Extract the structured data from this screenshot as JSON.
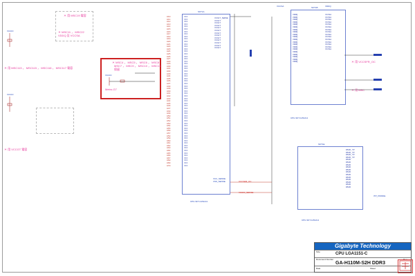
{
  "title_block": {
    "company": "Gigabyte Technology",
    "sheet_title": "CPU LGA1151-C",
    "board": "GA-H110M-S2H DDR3",
    "size_label": "Size",
    "size_value": "Custom",
    "doc_label": "Document Number",
    "rev_label": "Rev",
    "date_label": "Date",
    "sheet_label": "Sheet"
  },
  "notes": {
    "top_note_1": "＊ 用 MSC19 電容",
    "top_note_2": "＊ MSC11 ， MSC22",
    "top_note_3": "VDDQ 及 VCCSA",
    "left_note_1": "＊ 用 MSC113 ， MSC115 ， MSC116 ， MSC117 電容",
    "left_note_2": "＊ 用 VCCGT 電容",
    "red_note_1": "＊ MSC4 ， MSC5 ， MSC6 ， MSC8",
    "red_note_2": "MSC7 ， MSC9 ， MSC10 ， MSC11",
    "red_note_3": "保留",
    "red_note_4": "Metro-G7",
    "right_note_1": "＊ 用 VCCSFR_OC",
    "right_note_2": "＊ 用 MSC",
    "right_note_3": "＊ 用 VDDQ"
  },
  "power_labels": {
    "vccio": "VCCIO",
    "vccsa": "VCCSA",
    "vddq": "VDDQ",
    "vccgt": "VCCGT",
    "vcc": "VCC"
  },
  "chips": {
    "u1_top": "CPU-SKT-1151",
    "u1_bottom": "CPU-SKT-1151/H1",
    "u1_section": "SKT1A",
    "u2_bottom": "CPU-SKT-1151/H1",
    "u2_section": "SKT1B",
    "u3_section": "SKT1E",
    "u3_bottom": "CPU-SKT-1151/H1"
  },
  "left_pins": [
    "A10",
    "A11",
    "A12",
    "A13",
    "A14",
    "A15",
    "A16",
    "A17",
    "A18",
    "A19",
    "A20",
    "A21",
    "A22",
    "A23",
    "A24",
    "A25",
    "A26",
    "A27",
    "A28",
    "A29",
    "A30",
    "A31",
    "A32",
    "A33",
    "A34",
    "A35",
    "A36",
    "A37",
    "A38",
    "A39",
    "A40",
    "A41",
    "A42",
    "A43",
    "A44",
    "A45",
    "A46",
    "A47",
    "A48",
    "A49",
    "A50",
    "A51",
    "A52",
    "A53",
    "A54",
    "A55",
    "A56",
    "A57",
    "A58",
    "A59",
    "A60",
    "A61",
    "A62",
    "A63",
    "A64",
    "A65",
    "A66",
    "A67",
    "A68",
    "A69",
    "A70"
  ],
  "left_pin_names": [
    "VCC",
    "VCC",
    "VCC",
    "VCC",
    "VCC",
    "VCC",
    "VCC",
    "VCC",
    "VCC",
    "VCC",
    "VCC",
    "VCC",
    "VCC",
    "VCC",
    "VCC",
    "VCC",
    "VCC",
    "VCC",
    "VCC",
    "VCC",
    "VCC",
    "VCC",
    "VCC",
    "VCC",
    "VCC",
    "VCC",
    "VCC",
    "VCC",
    "VCC",
    "VCC",
    "VCC",
    "VCC",
    "VCC",
    "VCC",
    "VCC",
    "VCC",
    "VCC",
    "VCC",
    "VCC",
    "VCC",
    "VCC",
    "VCC",
    "VCC",
    "VCC",
    "VCC",
    "VCC",
    "VCC",
    "VCC",
    "VCC",
    "VCC",
    "VCC",
    "VCC",
    "VCC",
    "VCC",
    "VCC",
    "VCC",
    "VCC",
    "VCC",
    "VCC",
    "VCC",
    "VCC"
  ],
  "right_pin_names_1": [
    "VCCGT_SENSE",
    "VCCGT",
    "VCCGT",
    "VCCGT",
    "VCCGT",
    "VCCGT",
    "VCCGT",
    "VCCGT",
    "VCCGT",
    "VCCGT",
    "VCCGT",
    "VCCGT",
    "VCCGT"
  ],
  "mid_pins": [
    "VDDQ",
    "VDDQ",
    "VDDQ",
    "VDDQ",
    "VDDQ",
    "VDDQ",
    "VDDQ",
    "VDDQ",
    "VDDQ",
    "VDDQ",
    "VDDQ",
    "VDDQ",
    "VDDQ",
    "VDDQ",
    "VDDQ",
    "VDDQ",
    "VDDQ",
    "VDDQ",
    "VDDQ",
    "VDDQ"
  ],
  "mid_right_pins": [
    "VCCSA",
    "VCCSA",
    "VCCSA",
    "VCCSA",
    "VCCSA",
    "VCCSA",
    "VCCSA",
    "VCCSA",
    "VCCSA",
    "VCCSA",
    "VCCSA",
    "VCCSA",
    "VCCSA",
    "VCCSA",
    "VCCSA"
  ],
  "bottom_right_pins": [
    "RSVD_TP",
    "RSVD_TP",
    "RSVD_TP",
    "RSVD_TP",
    "RSVD",
    "RSVD",
    "RSVD",
    "RSVD",
    "RSVD",
    "RSVD",
    "RSVD",
    "RSVD",
    "RSVD",
    "RSVD",
    "RSVD",
    "RSVD"
  ],
  "signals": {
    "sig1": "VCC_SENSE",
    "sig2": "VSS_SENSE",
    "sig3": "VCCSFR_OC",
    "sig4": "VCCIO_SENSE",
    "sig5": "VCCST",
    "sig6": "VCCPLL",
    "sig7": "VCC_OPC_1P8",
    "sig8": "ITP_PMODE",
    "sig9": "CFG_RCOMP"
  }
}
